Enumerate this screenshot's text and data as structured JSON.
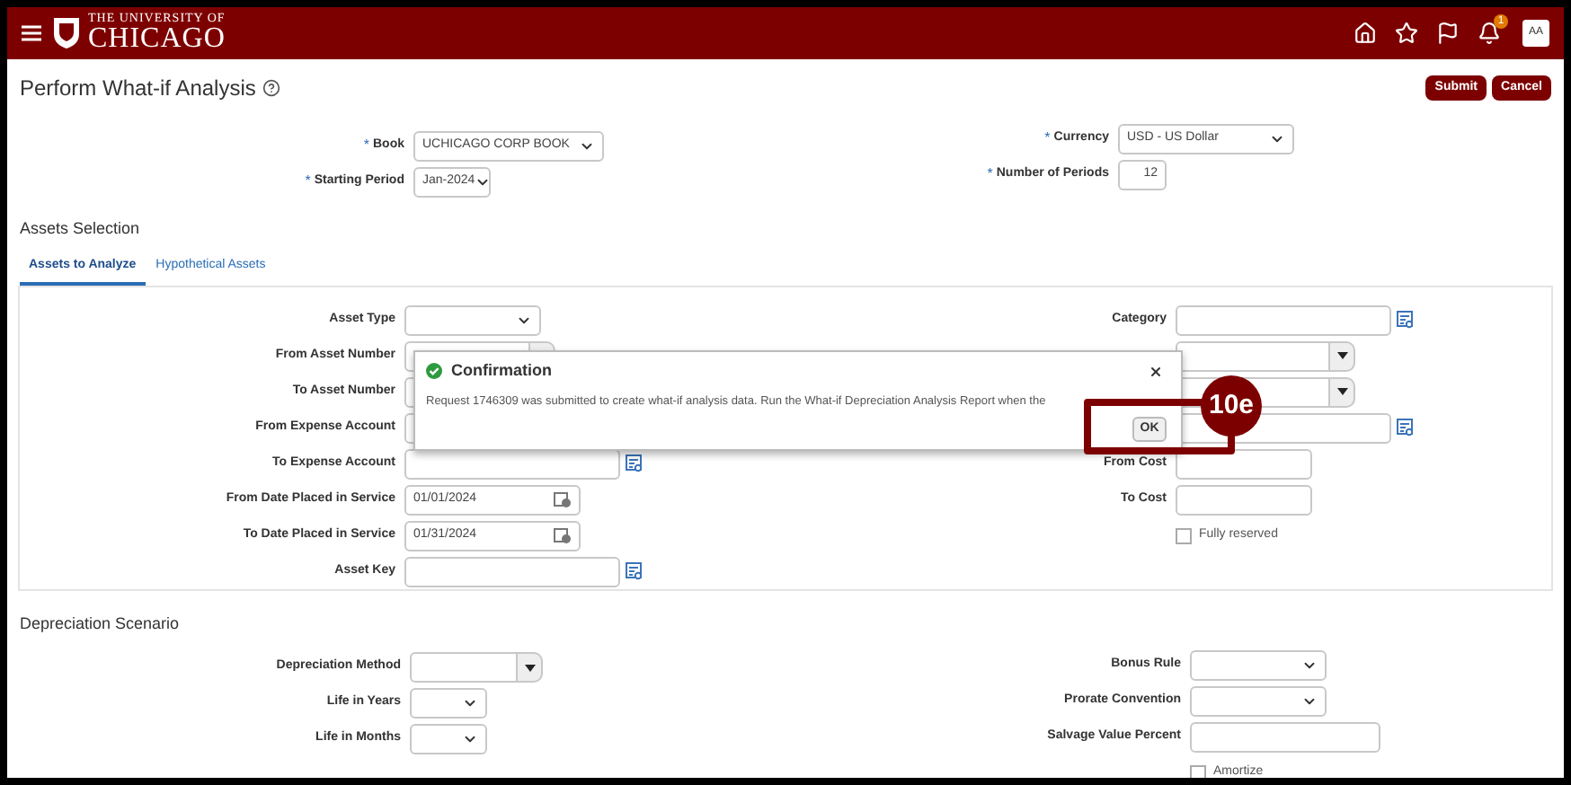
{
  "header": {
    "logo_line1": "THE UNIVERSITY OF",
    "logo_line2": "CHICAGO",
    "notification_count": "1",
    "avatar": "AA"
  },
  "page": {
    "title": "Perform What-if Analysis",
    "buttons": [
      "Submit",
      "Cancel"
    ]
  },
  "top_form": {
    "left": [
      {
        "label": "Book",
        "required_mark": "*",
        "kind": "select",
        "value": "UCHICAGO CORP BOOK"
      },
      {
        "label": "Starting Period",
        "required_mark": "*",
        "kind": "select",
        "value": "Jan-2024"
      }
    ],
    "right": [
      {
        "label": "Currency",
        "required_mark": "*",
        "kind": "select",
        "value": "USD - US Dollar"
      },
      {
        "label": "Number of Periods",
        "required_mark": "*",
        "kind": "number",
        "value": "12"
      }
    ]
  },
  "assets_selection": {
    "title": "Assets Selection",
    "tabs": [
      {
        "label": "Assets to Analyze",
        "selected": true
      },
      {
        "label": "Hypothetical Assets",
        "selected": false
      }
    ],
    "left": [
      {
        "label": "Asset Type",
        "kind": "select"
      },
      {
        "label": "From Asset Number",
        "kind": "combo"
      },
      {
        "label": "To Asset Number",
        "kind": "text"
      },
      {
        "label": "From Expense Account",
        "kind": "text"
      },
      {
        "label": "To Expense Account",
        "kind": "lookup"
      },
      {
        "label": "From Date Placed in Service",
        "kind": "date",
        "value": "01/01/2024"
      },
      {
        "label": "To Date Placed in Service",
        "kind": "date",
        "value": "01/31/2024"
      },
      {
        "label": "Asset Key",
        "kind": "lookup"
      }
    ],
    "right": [
      {
        "label": "Category",
        "kind": "lookup"
      },
      {
        "kind": "combo"
      },
      {
        "kind": "combo"
      },
      {
        "kind": "lookup"
      },
      {
        "label": "From Cost",
        "kind": "text"
      },
      {
        "label": "To Cost",
        "kind": "text"
      },
      {
        "label": "Fully reserved",
        "kind": "checkbox",
        "checked": false
      }
    ]
  },
  "depreciation_scenario": {
    "title": "Depreciation Scenario",
    "left": [
      {
        "label": "Depreciation Method",
        "kind": "combo"
      },
      {
        "label": "Life in Years",
        "kind": "select"
      },
      {
        "label": "Life in Months",
        "kind": "select"
      }
    ],
    "right": [
      {
        "label": "Bonus Rule",
        "kind": "select"
      },
      {
        "label": "Prorate Convention",
        "kind": "select"
      },
      {
        "label": "Salvage Value Percent",
        "kind": "text"
      },
      {
        "label": "Amortize",
        "kind": "checkbox",
        "checked": false
      }
    ]
  },
  "dialog": {
    "title": "Confirmation",
    "message": "Request 1746309 was submitted to create what-if analysis data. Run the What-if Depreciation Analysis Report when the",
    "button": "OK"
  },
  "callout": {
    "label": "10e"
  }
}
